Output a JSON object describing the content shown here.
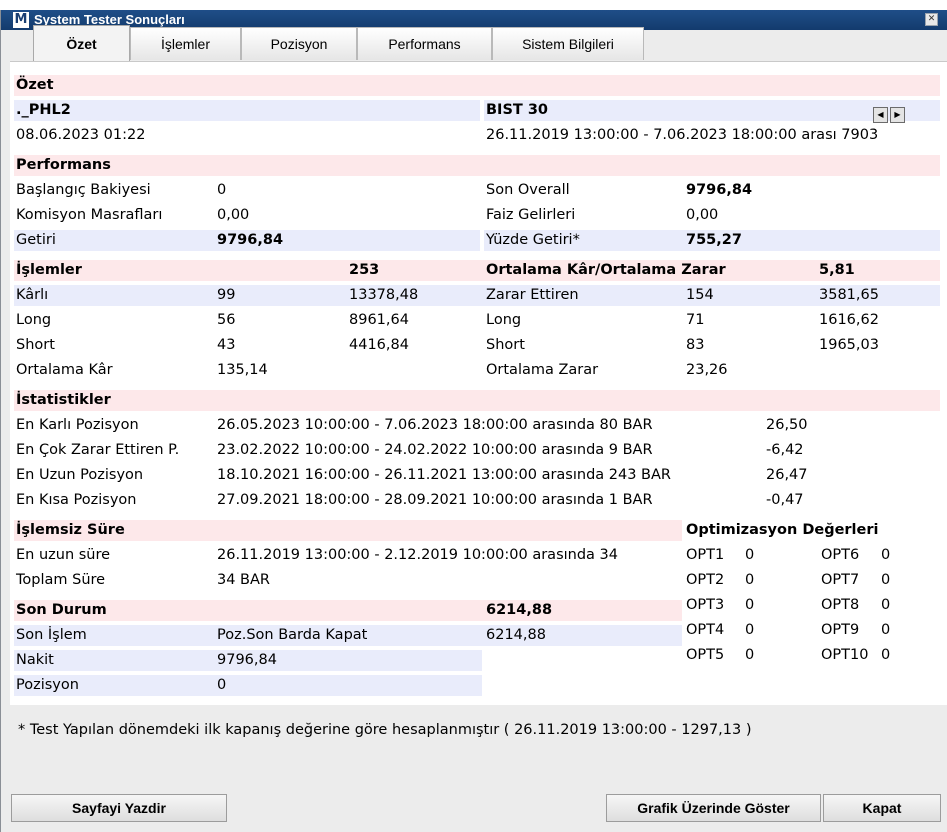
{
  "window": {
    "title": "System Tester Sonuçları",
    "icon_letter": "M"
  },
  "tabs": [
    "Özet",
    "İşlemler",
    "Pozisyon",
    "Performans",
    "Sistem Bilgileri"
  ],
  "summary": {
    "heading": "Özet",
    "system_name": "._PHL2",
    "symbol": "BIST 30",
    "run_date": "08.06.2023 01:22",
    "range": "26.11.2019 13:00:00 - 7.06.2023 18:00:00 arası 7903"
  },
  "performance": {
    "heading": "Performans",
    "rows": [
      {
        "label": "Başlangıç Bakiyesi",
        "value": "0",
        "label2": "Son Overall",
        "value2": "9796,84"
      },
      {
        "label": "Komisyon Masrafları",
        "value": "0,00",
        "label2": "Faiz Gelirleri",
        "value2": "0,00"
      },
      {
        "label": "Getiri",
        "value": "9796,84",
        "label2": "Yüzde Getiri*",
        "value2": "755,27"
      }
    ]
  },
  "trades": {
    "heading": "İşlemler",
    "count": "253",
    "ratio_label": "Ortalama Kâr/Ortalama Zarar",
    "ratio_value": "5,81",
    "rows": [
      {
        "label": "Kârlı",
        "n": "99",
        "amount": "13378,48",
        "label2": "Zarar Ettiren",
        "n2": "154",
        "amount2": "3581,65"
      },
      {
        "label": "Long",
        "n": "56",
        "amount": "8961,64",
        "label2": "Long",
        "n2": "71",
        "amount2": "1616,62"
      },
      {
        "label": "Short",
        "n": "43",
        "amount": "4416,84",
        "label2": "Short",
        "n2": "83",
        "amount2": "1965,03"
      },
      {
        "label": "Ortalama Kâr",
        "n": "135,14",
        "amount": "",
        "label2": "Ortalama Zarar",
        "n2": "23,26",
        "amount2": ""
      }
    ]
  },
  "stats": {
    "heading": "İstatistikler",
    "rows": [
      {
        "label": "En Karlı Pozisyon",
        "range": "26.05.2023 10:00:00 - 7.06.2023 18:00:00 arasında 80 BAR",
        "value": "26,50"
      },
      {
        "label": "En Çok Zarar Ettiren P.",
        "range": "23.02.2022 10:00:00 - 24.02.2022 10:00:00 arasında 9 BAR",
        "value": "-6,42"
      },
      {
        "label": "En Uzun Pozisyon",
        "range": "18.10.2021 16:00:00 - 26.11.2021 13:00:00 arasında 243 BAR",
        "value": "26,47"
      },
      {
        "label": "En Kısa Pozisyon",
        "range": "27.09.2021 18:00:00 - 28.09.2021 10:00:00 arasında 1 BAR",
        "value": "-0,47"
      }
    ]
  },
  "idle": {
    "heading": "İşlemsiz Süre",
    "rows": [
      {
        "label": "En uzun süre",
        "value": "26.11.2019 13:00:00 - 2.12.2019 10:00:00 arasında 34"
      },
      {
        "label": "Toplam Süre",
        "value": "34 BAR"
      }
    ]
  },
  "last": {
    "heading": "Son Durum",
    "total": "6214,88",
    "rows": [
      {
        "label": "Son İşlem",
        "value": "Poz.Son Barda Kapat",
        "extra": "6214,88"
      },
      {
        "label": "Nakit",
        "value": "9796,84",
        "extra": ""
      },
      {
        "label": "Pozisyon",
        "value": "0",
        "extra": ""
      }
    ]
  },
  "optimization": {
    "heading": "Optimizasyon Değerleri",
    "left": [
      {
        "name": "OPT1",
        "value": "0"
      },
      {
        "name": "OPT2",
        "value": "0"
      },
      {
        "name": "OPT3",
        "value": "0"
      },
      {
        "name": "OPT4",
        "value": "0"
      },
      {
        "name": "OPT5",
        "value": "0"
      }
    ],
    "right": [
      {
        "name": "OPT6",
        "value": "0"
      },
      {
        "name": "OPT7",
        "value": "0"
      },
      {
        "name": "OPT8",
        "value": "0"
      },
      {
        "name": "OPT9",
        "value": "0"
      },
      {
        "name": "OPT10",
        "value": "0"
      }
    ]
  },
  "footnote": "* Test Yapılan dönemdeki ilk kapanış değerine göre hesaplanmıştır ( 26.11.2019 13:00:00 - 1297,13 )",
  "buttons": {
    "print": "Sayfayi Yazdir",
    "show_chart": "Grafik Üzerinde Göster",
    "close": "Kapat"
  },
  "colors": {
    "titlebar": "#1a4478",
    "section_bg": "#fde8ea",
    "highlight_bg": "#e9ecfb"
  }
}
